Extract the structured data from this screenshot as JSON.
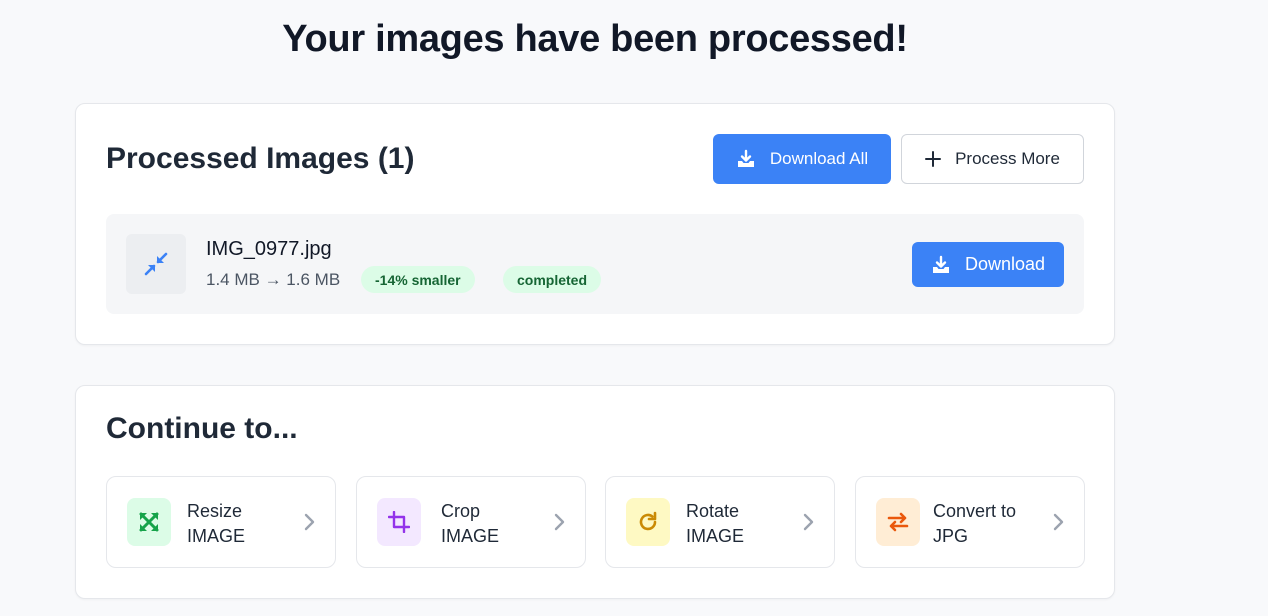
{
  "page": {
    "title": "Your images have been processed!"
  },
  "processed": {
    "title": "Processed Images (1)",
    "download_all_label": "Download All",
    "process_more_label": "Process More",
    "files": [
      {
        "name": "IMG_0977.jpg",
        "size_text": "1.4 MB → 1.6 MB",
        "savings_badge": "-14% smaller",
        "status_badge": "completed",
        "download_label": "Download",
        "thumb_icon": "compress-arrows-icon"
      }
    ]
  },
  "continue": {
    "title": "Continue to...",
    "tools": [
      {
        "line1": "Resize",
        "line2": "IMAGE",
        "icon": "resize-icon",
        "icon_bg": "#dcfce7",
        "icon_color": "#16a34a"
      },
      {
        "line1": "Crop",
        "line2": "IMAGE",
        "icon": "crop-icon",
        "icon_bg": "#f3e8ff",
        "icon_color": "#9333ea"
      },
      {
        "line1": "Rotate",
        "line2": "IMAGE",
        "icon": "rotate-icon",
        "icon_bg": "#fef9c3",
        "icon_color": "#ca8a04"
      },
      {
        "line1": "Convert to",
        "line2": "JPG",
        "icon": "convert-icon",
        "icon_bg": "#ffedd5",
        "icon_color": "#ea580c"
      }
    ]
  },
  "colors": {
    "primary": "#3b82f6",
    "badge_bg": "#dcfce7",
    "badge_text": "#166534"
  }
}
